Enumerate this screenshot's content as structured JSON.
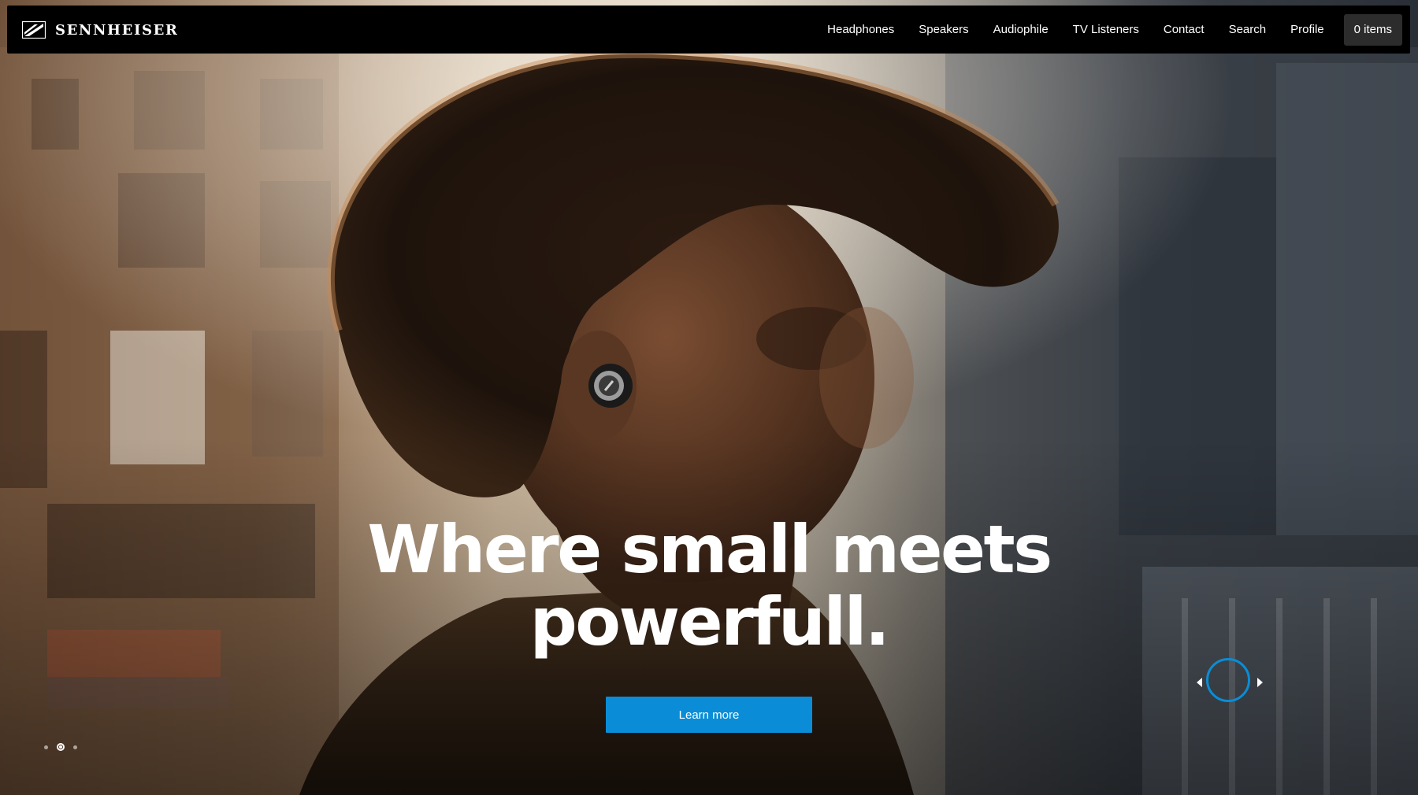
{
  "brand": {
    "name": "SENNHEISER"
  },
  "nav": {
    "items": [
      {
        "label": "Headphones"
      },
      {
        "label": "Speakers"
      },
      {
        "label": "Audiophile"
      },
      {
        "label": "TV Listeners"
      },
      {
        "label": "Contact"
      },
      {
        "label": "Search"
      },
      {
        "label": "Profile"
      }
    ],
    "cart_label": "0 items"
  },
  "hero": {
    "headline_line1": "Where small meets",
    "headline_line2": "powerfull.",
    "cta_label": "Learn more",
    "slides_count": 3,
    "active_slide": 2
  },
  "colors": {
    "accent": "#0a8dd6",
    "nav_bg": "#000000",
    "cart_bg": "#2c2c2c"
  },
  "icons": {
    "logo": "sennheiser-logo-icon",
    "prev": "chevron-left-icon",
    "next": "chevron-right-icon",
    "progress": "autoplay-ring-icon"
  }
}
